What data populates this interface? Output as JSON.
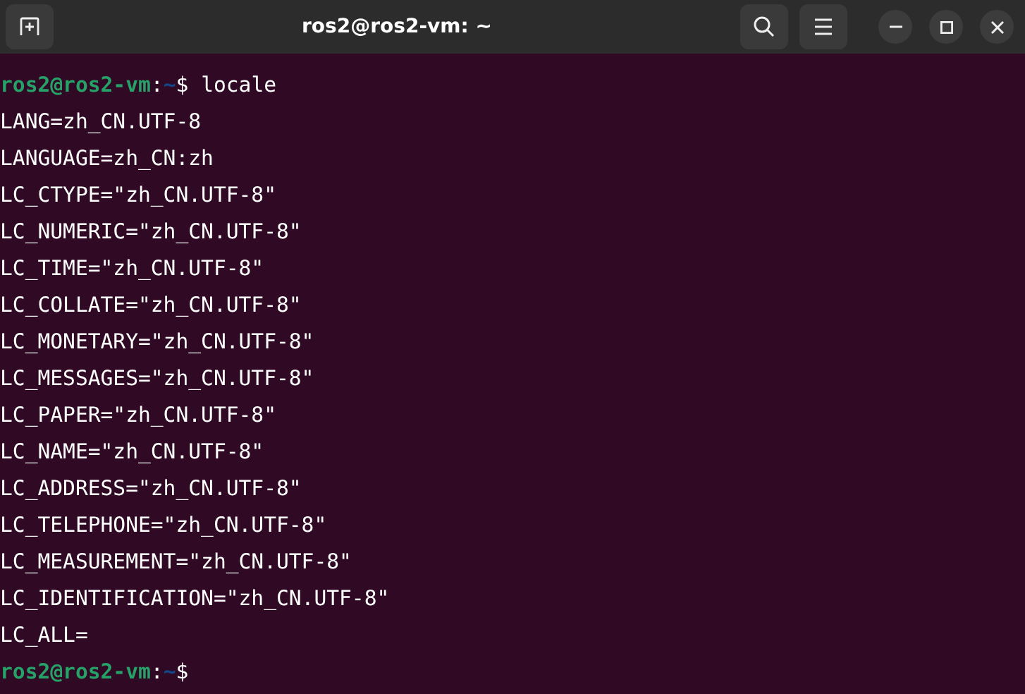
{
  "window": {
    "title": "ros2@ros2-vm: ~"
  },
  "lines": [
    {
      "kind": "prompt",
      "user_host": "ros2@ros2-vm",
      "separator": ":",
      "path": "~",
      "symbol": "$",
      "command": " locale"
    },
    {
      "kind": "output",
      "text": "LANG=zh_CN.UTF-8"
    },
    {
      "kind": "output",
      "text": "LANGUAGE=zh_CN:zh"
    },
    {
      "kind": "output",
      "text": "LC_CTYPE=\"zh_CN.UTF-8\""
    },
    {
      "kind": "output",
      "text": "LC_NUMERIC=\"zh_CN.UTF-8\""
    },
    {
      "kind": "output",
      "text": "LC_TIME=\"zh_CN.UTF-8\""
    },
    {
      "kind": "output",
      "text": "LC_COLLATE=\"zh_CN.UTF-8\""
    },
    {
      "kind": "output",
      "text": "LC_MONETARY=\"zh_CN.UTF-8\""
    },
    {
      "kind": "output",
      "text": "LC_MESSAGES=\"zh_CN.UTF-8\""
    },
    {
      "kind": "output",
      "text": "LC_PAPER=\"zh_CN.UTF-8\""
    },
    {
      "kind": "output",
      "text": "LC_NAME=\"zh_CN.UTF-8\""
    },
    {
      "kind": "output",
      "text": "LC_ADDRESS=\"zh_CN.UTF-8\""
    },
    {
      "kind": "output",
      "text": "LC_TELEPHONE=\"zh_CN.UTF-8\""
    },
    {
      "kind": "output",
      "text": "LC_MEASUREMENT=\"zh_CN.UTF-8\""
    },
    {
      "kind": "output",
      "text": "LC_IDENTIFICATION=\"zh_CN.UTF-8\""
    },
    {
      "kind": "output",
      "text": "LC_ALL="
    },
    {
      "kind": "prompt",
      "user_host": "ros2@ros2-vm",
      "separator": ":",
      "path": "~",
      "symbol": "$"
    }
  ]
}
